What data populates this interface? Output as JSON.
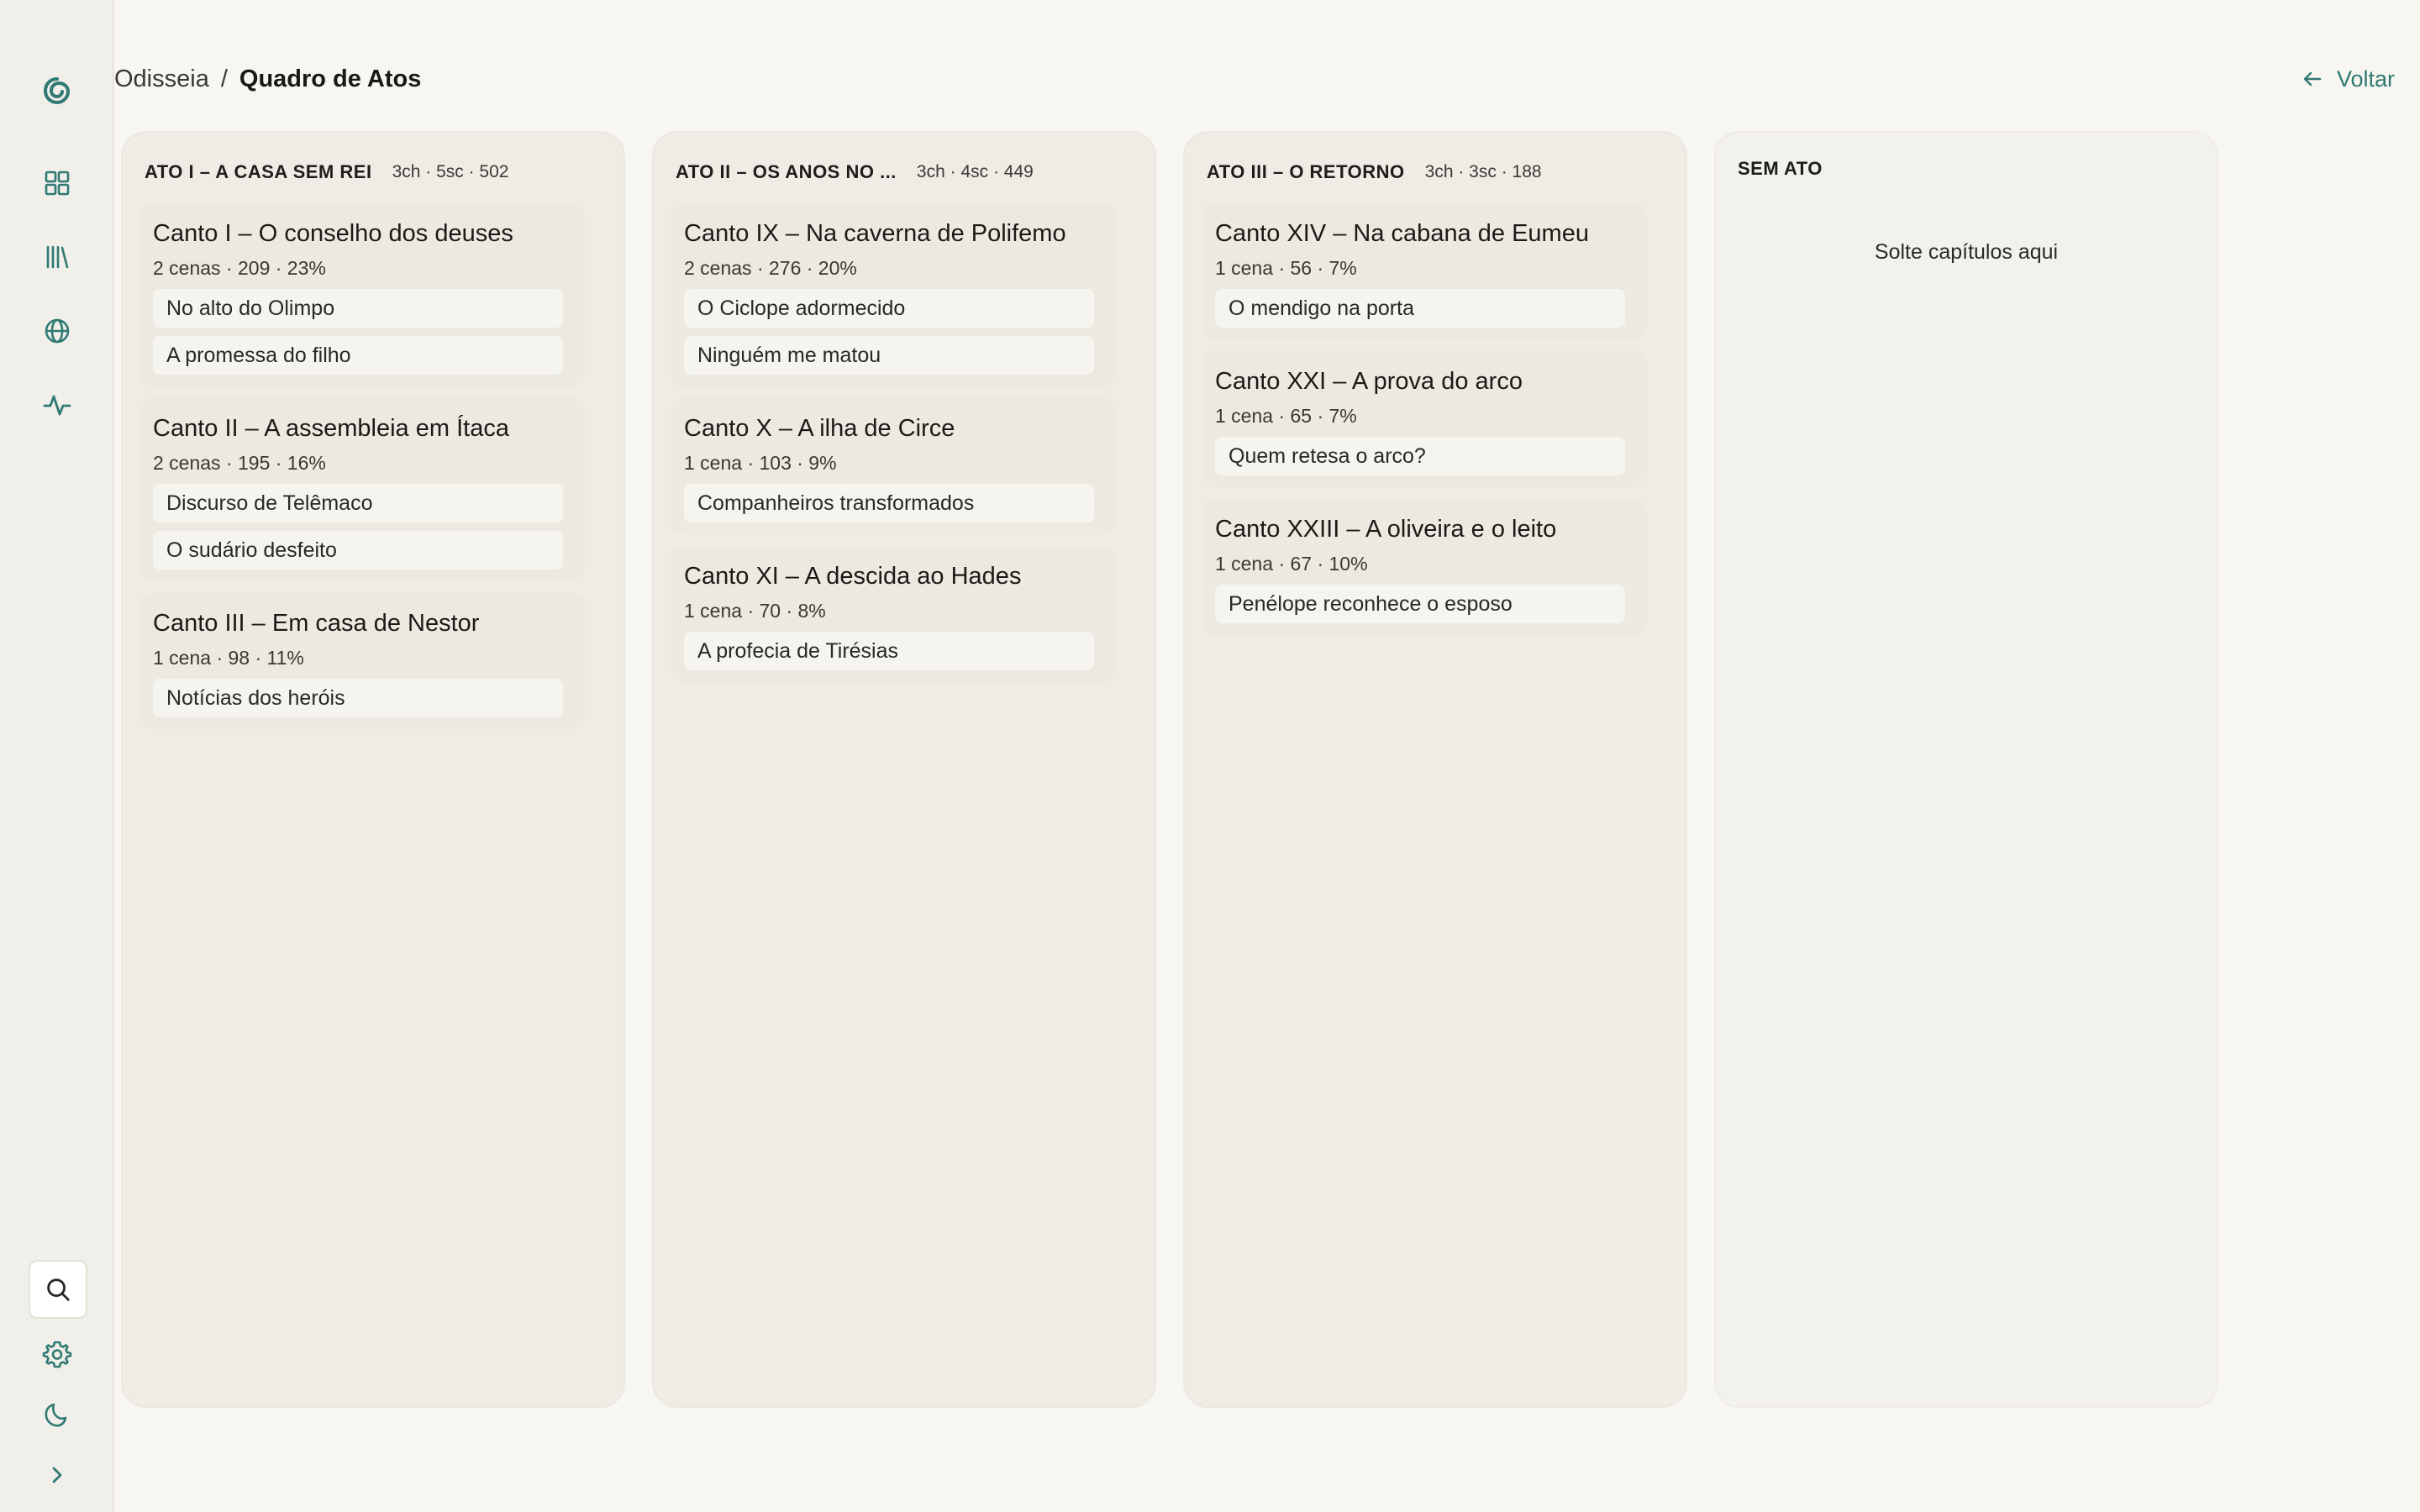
{
  "breadcrumb": {
    "root": "Odisseia",
    "separator": "/",
    "current": "Quadro de Atos"
  },
  "back_label": "Voltar",
  "sidebar": {
    "icons": [
      "logo-icon",
      "grid-icon",
      "library-icon",
      "globe-icon",
      "activity-icon",
      "search-icon",
      "gear-icon",
      "moon-icon",
      "chevron-right-icon"
    ]
  },
  "colors": {
    "accent": "#2f7a73",
    "background": "#f8f6f1",
    "column": "#efece5"
  },
  "columns": [
    {
      "title": "ATO I – A CASA SEM REI",
      "stats": "3ch · 5sc · 502",
      "chapters": [
        {
          "title": "Canto I – O conselho dos deuses",
          "meta": "2 cenas · 209 · 23%",
          "scenes": [
            "No alto do Olimpo",
            "A promessa do filho"
          ]
        },
        {
          "title": "Canto II – A assembleia em Ítaca",
          "meta": "2 cenas · 195 · 16%",
          "scenes": [
            "Discurso de Telêmaco",
            "O sudário desfeito"
          ]
        },
        {
          "title": "Canto III – Em casa de Nestor",
          "meta": "1 cena · 98 · 11%",
          "scenes": [
            "Notícias dos heróis"
          ]
        }
      ]
    },
    {
      "title": "ATO II – OS ANOS NO ...",
      "stats": "3ch · 4sc · 449",
      "chapters": [
        {
          "title": "Canto IX – Na caverna de Polifemo",
          "meta": "2 cenas · 276 · 20%",
          "scenes": [
            "O Ciclope adormecido",
            "Ninguém me matou"
          ]
        },
        {
          "title": "Canto X – A ilha de Circe",
          "meta": "1 cena · 103 · 9%",
          "scenes": [
            "Companheiros transformados"
          ]
        },
        {
          "title": "Canto XI – A descida ao Hades",
          "meta": "1 cena · 70 · 8%",
          "scenes": [
            "A profecia de Tirésias"
          ]
        }
      ]
    },
    {
      "title": "ATO III – O RETORNO",
      "stats": "3ch · 3sc · 188",
      "chapters": [
        {
          "title": "Canto XIV – Na cabana de Eumeu",
          "meta": "1 cena · 56 · 7%",
          "scenes": [
            "O mendigo na porta"
          ]
        },
        {
          "title": "Canto XXI – A prova do arco",
          "meta": "1 cena · 65 · 7%",
          "scenes": [
            "Quem retesa o arco?"
          ]
        },
        {
          "title": "Canto XXIII – A oliveira e o leito",
          "meta": "1 cena · 67 · 10%",
          "scenes": [
            "Penélope reconhece o esposo"
          ]
        }
      ]
    },
    {
      "title": "SEM ATO",
      "stats": "",
      "drop_hint": "Solte capítulos aqui",
      "chapters": []
    }
  ]
}
